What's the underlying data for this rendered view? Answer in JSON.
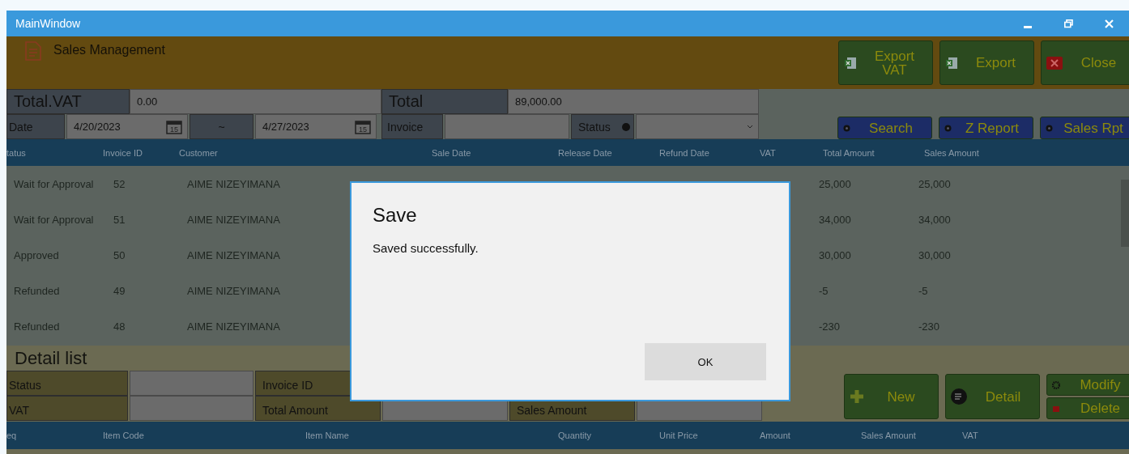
{
  "window": {
    "title": "MainWindow"
  },
  "header": {
    "title": "Sales Management",
    "buttons": [
      {
        "label": "Export VAT",
        "kind": "excel"
      },
      {
        "label": "Export",
        "kind": "excel"
      },
      {
        "label": "Close",
        "kind": "close"
      }
    ]
  },
  "summary": [
    {
      "label": "Total.VAT",
      "value": "0.00"
    },
    {
      "label": "Total",
      "value": "89,000.00"
    }
  ],
  "filter": {
    "date_label": "Date",
    "date_from": {
      "value": "4/20/2023",
      "calendar_day": "15"
    },
    "separator": "~",
    "date_to": {
      "value": "4/27/2023",
      "calendar_day": "15"
    },
    "invoice_label": "Invoice",
    "status_label": "Status",
    "buttons": [
      {
        "label": "Search"
      },
      {
        "label": "Z Report"
      },
      {
        "label": "Sales Rpt"
      }
    ]
  },
  "table": {
    "columns": [
      "tatus",
      "Invoice ID",
      "Customer",
      "Sale Date",
      "Release Date",
      "Refund Date",
      "VAT",
      "Total Amount",
      "Sales Amount"
    ],
    "rows": [
      {
        "status": "Wait for Approval",
        "invoice_id": "52",
        "customer": "AIME NIZEYIMANA",
        "total_amount": "25,000",
        "sales_amount": "25,000"
      },
      {
        "status": "Wait for Approval",
        "invoice_id": "51",
        "customer": "AIME NIZEYIMANA",
        "total_amount": "34,000",
        "sales_amount": "34,000"
      },
      {
        "status": "Approved",
        "invoice_id": "50",
        "customer": "AIME NIZEYIMANA",
        "total_amount": "30,000",
        "sales_amount": "30,000"
      },
      {
        "status": "Refunded",
        "invoice_id": "49",
        "customer": "AIME NIZEYIMANA",
        "total_amount": "-5",
        "sales_amount": "-5"
      },
      {
        "status": "Refunded",
        "invoice_id": "48",
        "customer": "AIME NIZEYIMANA",
        "total_amount": "-230",
        "sales_amount": "-230"
      }
    ]
  },
  "detail": {
    "title": "Detail list",
    "rows": [
      [
        {
          "label": "Status"
        },
        {
          "label": "Invoice ID",
          "field": false
        }
      ],
      [
        {
          "label": "VAT"
        },
        {
          "label": "Total Amount"
        },
        {
          "label": "Sales Amount"
        }
      ]
    ],
    "buttons": [
      {
        "label": "New",
        "kind": "plus"
      },
      {
        "label": "Detail",
        "kind": "list"
      }
    ],
    "small_buttons": [
      {
        "label": "Modify",
        "kind": "gear"
      },
      {
        "label": "Delete",
        "kind": "trash"
      }
    ]
  },
  "items_table": {
    "columns": [
      "eq",
      "Item Code",
      "Item Name",
      "Quantity",
      "Unit Price",
      "Amount",
      "Sales Amount",
      "VAT"
    ]
  },
  "dialog": {
    "title": "Save",
    "message": "Saved successfully.",
    "button": "OK"
  }
}
